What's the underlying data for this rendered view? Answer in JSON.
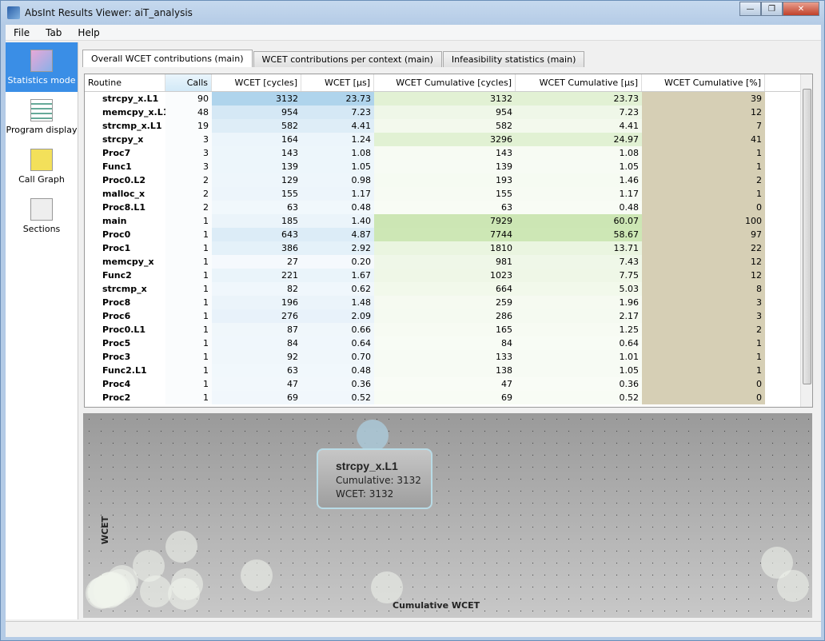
{
  "window": {
    "title": "AbsInt Results Viewer: aiT_analysis",
    "min": "—",
    "max": "❐",
    "close": "✕"
  },
  "menu": [
    "File",
    "Tab",
    "Help"
  ],
  "sidebar": [
    {
      "label": "Statistics mode",
      "icon": "statistics-icon",
      "selected": true
    },
    {
      "label": "Program display",
      "icon": "program-icon"
    },
    {
      "label": "Call Graph",
      "icon": "callgraph-icon"
    },
    {
      "label": "Sections",
      "icon": "sections-icon"
    }
  ],
  "tabs": [
    {
      "label": "Overall WCET contributions (main)",
      "selected": true
    },
    {
      "label": "WCET contributions per context (main)"
    },
    {
      "label": "Infeasibility statistics (main)"
    }
  ],
  "table": {
    "columns": [
      "Routine",
      "Calls",
      "WCET [cycles]",
      "WCET [µs]",
      "WCET Cumulative [cycles]",
      "WCET Cumulative [µs]",
      "WCET Cumulative [%]"
    ],
    "sort_column": "Calls",
    "rows": [
      [
        "strcpy_x.L1",
        "90",
        "3132",
        "23.73",
        "3132",
        "23.73",
        "39"
      ],
      [
        "memcpy_x.L1",
        "48",
        "954",
        "7.23",
        "954",
        "7.23",
        "12"
      ],
      [
        "strcmp_x.L1",
        "19",
        "582",
        "4.41",
        "582",
        "4.41",
        "7"
      ],
      [
        "strcpy_x",
        "3",
        "164",
        "1.24",
        "3296",
        "24.97",
        "41"
      ],
      [
        "Proc7",
        "3",
        "143",
        "1.08",
        "143",
        "1.08",
        "1"
      ],
      [
        "Func1",
        "3",
        "139",
        "1.05",
        "139",
        "1.05",
        "1"
      ],
      [
        "Proc0.L2",
        "2",
        "129",
        "0.98",
        "193",
        "1.46",
        "2"
      ],
      [
        "malloc_x",
        "2",
        "155",
        "1.17",
        "155",
        "1.17",
        "1"
      ],
      [
        "Proc8.L1",
        "2",
        "63",
        "0.48",
        "63",
        "0.48",
        "0"
      ],
      [
        "main",
        "1",
        "185",
        "1.40",
        "7929",
        "60.07",
        "100"
      ],
      [
        "Proc0",
        "1",
        "643",
        "4.87",
        "7744",
        "58.67",
        "97"
      ],
      [
        "Proc1",
        "1",
        "386",
        "2.92",
        "1810",
        "13.71",
        "22"
      ],
      [
        "memcpy_x",
        "1",
        "27",
        "0.20",
        "981",
        "7.43",
        "12"
      ],
      [
        "Func2",
        "1",
        "221",
        "1.67",
        "1023",
        "7.75",
        "12"
      ],
      [
        "strcmp_x",
        "1",
        "82",
        "0.62",
        "664",
        "5.03",
        "8"
      ],
      [
        "Proc8",
        "1",
        "196",
        "1.48",
        "259",
        "1.96",
        "3"
      ],
      [
        "Proc6",
        "1",
        "276",
        "2.09",
        "286",
        "2.17",
        "3"
      ],
      [
        "Proc0.L1",
        "1",
        "87",
        "0.66",
        "165",
        "1.25",
        "2"
      ],
      [
        "Proc5",
        "1",
        "84",
        "0.64",
        "84",
        "0.64",
        "1"
      ],
      [
        "Proc3",
        "1",
        "92",
        "0.70",
        "133",
        "1.01",
        "1"
      ],
      [
        "Func2.L1",
        "1",
        "63",
        "0.48",
        "138",
        "1.05",
        "1"
      ],
      [
        "Proc4",
        "1",
        "47",
        "0.36",
        "47",
        "0.36",
        "0"
      ],
      [
        "Proc2",
        "1",
        "69",
        "0.52",
        "69",
        "0.52",
        "0"
      ]
    ]
  },
  "colors": {
    "wcet": "#a8d0ea",
    "cumulative": "#c8e2b0",
    "percent": "#d6cfb5",
    "selected": "#3a8ee6"
  },
  "chart": {
    "xlabel": "Cumulative WCET",
    "ylabel": "WCET",
    "tooltip": {
      "title": "strcpy_x.L1",
      "cumulative": "Cumulative: 3132",
      "wcet": "WCET: 3132"
    }
  }
}
